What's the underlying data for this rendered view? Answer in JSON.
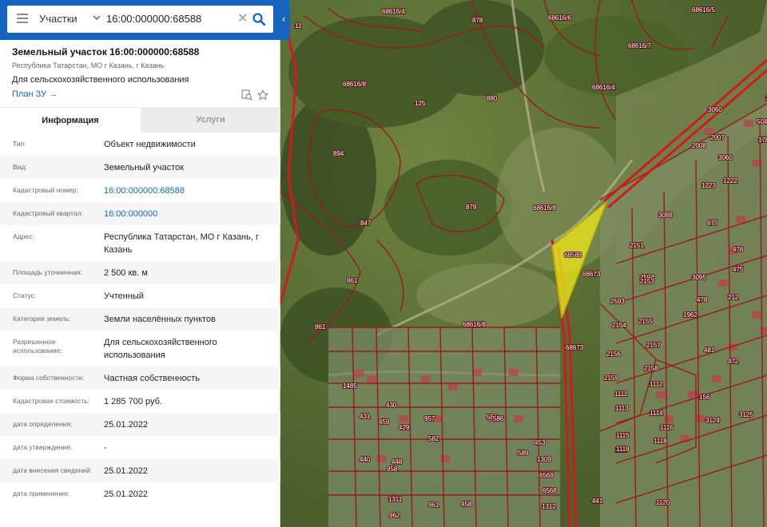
{
  "search": {
    "layer": "Участки",
    "query": "16:00:000000:68588"
  },
  "card": {
    "title": "Земельный участок 16:00:000000:68588",
    "address_short": "Республика Татарстан, МО г Казань, г Казань",
    "purpose": "Для сельскохозяйственного использования",
    "plan_link": "План ЗУ →"
  },
  "tabs": [
    "Информация",
    "Услуги"
  ],
  "rows": [
    {
      "key": "Тип:",
      "value": "Объект недвижимости",
      "link": false
    },
    {
      "key": "Вид:",
      "value": "Земельный участок",
      "link": false
    },
    {
      "key": "Кадастровый номер:",
      "value": "16:00:000000:68588",
      "link": true
    },
    {
      "key": "Кадастровый квартал:",
      "value": "16:00:000000",
      "link": true
    },
    {
      "key": "Адрес:",
      "value": "Республика Татарстан, МО г Казань, г Казань",
      "link": false
    },
    {
      "key": "Площадь уточненная:",
      "value": "2 500 кв. м",
      "link": false
    },
    {
      "key": "Статус:",
      "value": "Учтенный",
      "link": false
    },
    {
      "key": "Категория земель:",
      "value": "Земли населённых пунктов",
      "link": false
    },
    {
      "key": "Разрешенное использование:",
      "value": "Для сельскохозяйственного использования",
      "link": false
    },
    {
      "key": "Форма собственности:",
      "value": "Частная собственность",
      "link": false
    },
    {
      "key": "Кадастровая стоимость:",
      "value": "1 285 700 руб.",
      "link": false
    },
    {
      "key": "дата определения:",
      "value": "25.01.2022",
      "link": false
    },
    {
      "key": "дата утверждения:",
      "value": "-",
      "link": false
    },
    {
      "key": "дата внесения сведений:",
      "value": "25.01.2022",
      "link": false
    },
    {
      "key": "дата применения:",
      "value": "25.01.2022",
      "link": false
    }
  ],
  "map": {
    "labels": [
      "11",
      "68616/4",
      "878",
      "68616/6",
      "68616/5",
      "68616/7",
      "68616/4",
      "68616/8",
      "880",
      "3060",
      "894",
      "879",
      "68616/8",
      "847",
      "861",
      "861",
      "68616/8",
      "68673",
      "68673",
      "68588",
      "2007",
      "2008",
      "3060",
      "1223",
      "1222",
      "3088",
      "477",
      "476",
      "475",
      "3095",
      "478",
      "212",
      "1962",
      "481",
      "472",
      "156",
      "3124",
      "3125",
      "2151",
      "2594",
      "2153",
      "2593",
      "2155",
      "2154",
      "2157",
      "2156",
      "2158",
      "2159",
      "1111",
      "1112",
      "1113",
      "1114",
      "1116",
      "1118",
      "1115",
      "1117",
      "1119",
      "1120",
      "1485",
      "430",
      "429",
      "958",
      "957",
      "582",
      "583",
      "586",
      "589",
      "453",
      "1309",
      "6569",
      "6568",
      "1312",
      "1311",
      "962",
      "961",
      "458",
      "459",
      "431",
      "440",
      "448",
      "441",
      "504",
      "1784",
      "1787",
      "125"
    ],
    "colors": {
      "parcel": "#9b1a1a",
      "selected": "#e9e21a",
      "road": "#d11a1a"
    }
  }
}
